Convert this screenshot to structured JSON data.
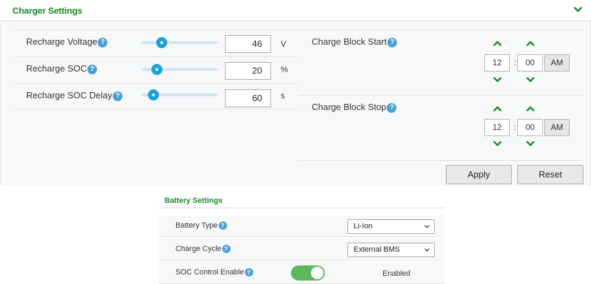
{
  "charger": {
    "title": "Charger Settings",
    "collapse_icon": "chevron-down-icon",
    "help_glyph": "?",
    "rows": [
      {
        "label": "Recharge Voltage",
        "value": "46",
        "unit": "V",
        "slider_fraction": 0.26
      },
      {
        "label": "Recharge SOC",
        "value": "20",
        "unit": "%",
        "slider_fraction": 0.2
      },
      {
        "label": "Recharge SOC Delay",
        "value": "60",
        "unit": "s",
        "slider_fraction": 0.15
      }
    ],
    "block_start": {
      "label": "Charge Block Start",
      "hour": "12",
      "minute": "00",
      "colon": ":",
      "ampm": "AM"
    },
    "block_stop": {
      "label": "Charge Block Stop",
      "hour": "12",
      "minute": "00",
      "colon": ":",
      "ampm": "AM"
    },
    "apply_label": "Apply",
    "reset_label": "Reset"
  },
  "battery": {
    "title": "Battery Settings",
    "rows": [
      {
        "label": "Battery Type",
        "value": "Li-Ion"
      },
      {
        "label": "Charge Cycle",
        "value": "External BMS"
      },
      {
        "label": "SOC Control Enable",
        "status": "Enabled",
        "toggle_on": true
      }
    ]
  },
  "colors": {
    "accent_green": "#1a8a2a",
    "slider_blue": "#1ea0dc",
    "help_blue": "#4a9fd6",
    "toggle_green": "#5cb85c"
  }
}
